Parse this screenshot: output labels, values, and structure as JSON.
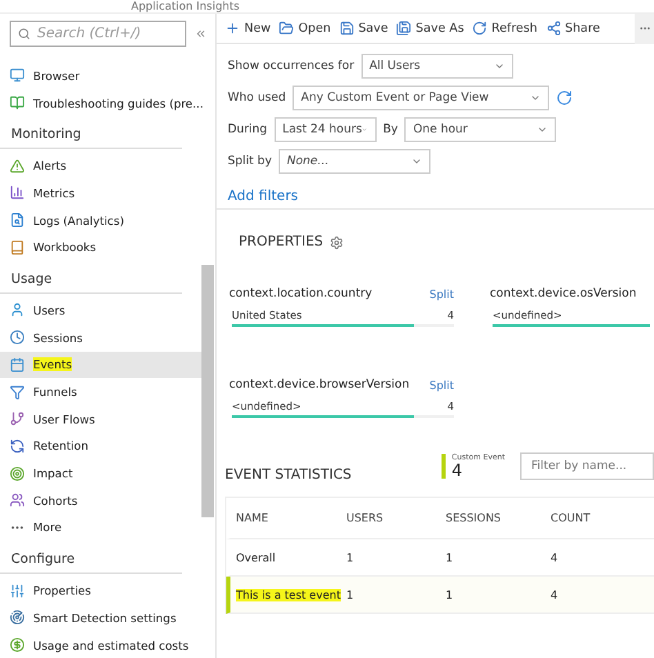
{
  "header": {
    "title": "Application Insights"
  },
  "sidebar": {
    "search_placeholder": "Search (Ctrl+/)",
    "groups": [
      {
        "items": [
          {
            "label": "Browser",
            "selected": false,
            "highlighted": false
          },
          {
            "label": "Troubleshooting guides (pre...",
            "selected": false,
            "highlighted": false
          }
        ]
      },
      {
        "heading": "Monitoring",
        "items": [
          {
            "label": "Alerts",
            "selected": false,
            "highlighted": false
          },
          {
            "label": "Metrics",
            "selected": false,
            "highlighted": false
          },
          {
            "label": "Logs (Analytics)",
            "selected": false,
            "highlighted": false
          },
          {
            "label": "Workbooks",
            "selected": false,
            "highlighted": false
          }
        ]
      },
      {
        "heading": "Usage",
        "items": [
          {
            "label": "Users",
            "selected": false,
            "highlighted": false
          },
          {
            "label": "Sessions",
            "selected": false,
            "highlighted": false
          },
          {
            "label": "Events",
            "selected": true,
            "highlighted": true
          },
          {
            "label": "Funnels",
            "selected": false,
            "highlighted": false
          },
          {
            "label": "User Flows",
            "selected": false,
            "highlighted": false
          },
          {
            "label": "Retention",
            "selected": false,
            "highlighted": false
          },
          {
            "label": "Impact",
            "selected": false,
            "highlighted": false
          },
          {
            "label": "Cohorts",
            "selected": false,
            "highlighted": false
          },
          {
            "label": "More",
            "selected": false,
            "highlighted": false
          }
        ]
      },
      {
        "heading": "Configure",
        "items": [
          {
            "label": "Properties",
            "selected": false,
            "highlighted": false
          },
          {
            "label": "Smart Detection settings",
            "selected": false,
            "highlighted": false
          },
          {
            "label": "Usage and estimated costs",
            "selected": false,
            "highlighted": false
          }
        ]
      }
    ]
  },
  "toolbar": {
    "buttons": [
      {
        "label": "New"
      },
      {
        "label": "Open"
      },
      {
        "label": "Save"
      },
      {
        "label": "Save As"
      },
      {
        "label": "Refresh"
      },
      {
        "label": "Share"
      }
    ]
  },
  "filters": {
    "show_occurrences_for": {
      "label": "Show occurrences for",
      "value": "All Users"
    },
    "who_used": {
      "label": "Who used",
      "value": "Any Custom Event or Page View"
    },
    "during": {
      "label": "During",
      "value": "Last 24 hours"
    },
    "by": {
      "label": "By",
      "value": "One hour"
    },
    "split_by": {
      "label": "Split by",
      "placeholder": "None..."
    },
    "add_filters": "Add filters"
  },
  "properties": {
    "title": "PROPERTIES",
    "cards": [
      {
        "title": "context.location.country",
        "split": "Split",
        "rows": [
          {
            "value": "United States",
            "count": "4",
            "level": 0.82
          }
        ]
      },
      {
        "title": "context.device.osVersion",
        "rows": [
          {
            "value": "<undefined>",
            "level": 1
          }
        ]
      },
      {
        "title": "context.device.browserVersion",
        "split": "Split",
        "rows": [
          {
            "value": "<undefined>",
            "count": "4",
            "level": 0.82
          }
        ]
      }
    ]
  },
  "event_statistics": {
    "title": "EVENT STATISTICS",
    "custom_event": {
      "label": "Custom Event",
      "count": "4"
    },
    "filter_placeholder": "Filter by name...",
    "columns": [
      "NAME",
      "USERS",
      "SESSIONS",
      "COUNT"
    ],
    "rows": [
      {
        "cells": [
          "Overall",
          "1",
          "1",
          "4"
        ],
        "selected": false,
        "highlighted": false
      },
      {
        "cells": [
          "This is a test event",
          "1",
          "1",
          "4"
        ],
        "selected": true,
        "highlighted": true
      }
    ]
  }
}
